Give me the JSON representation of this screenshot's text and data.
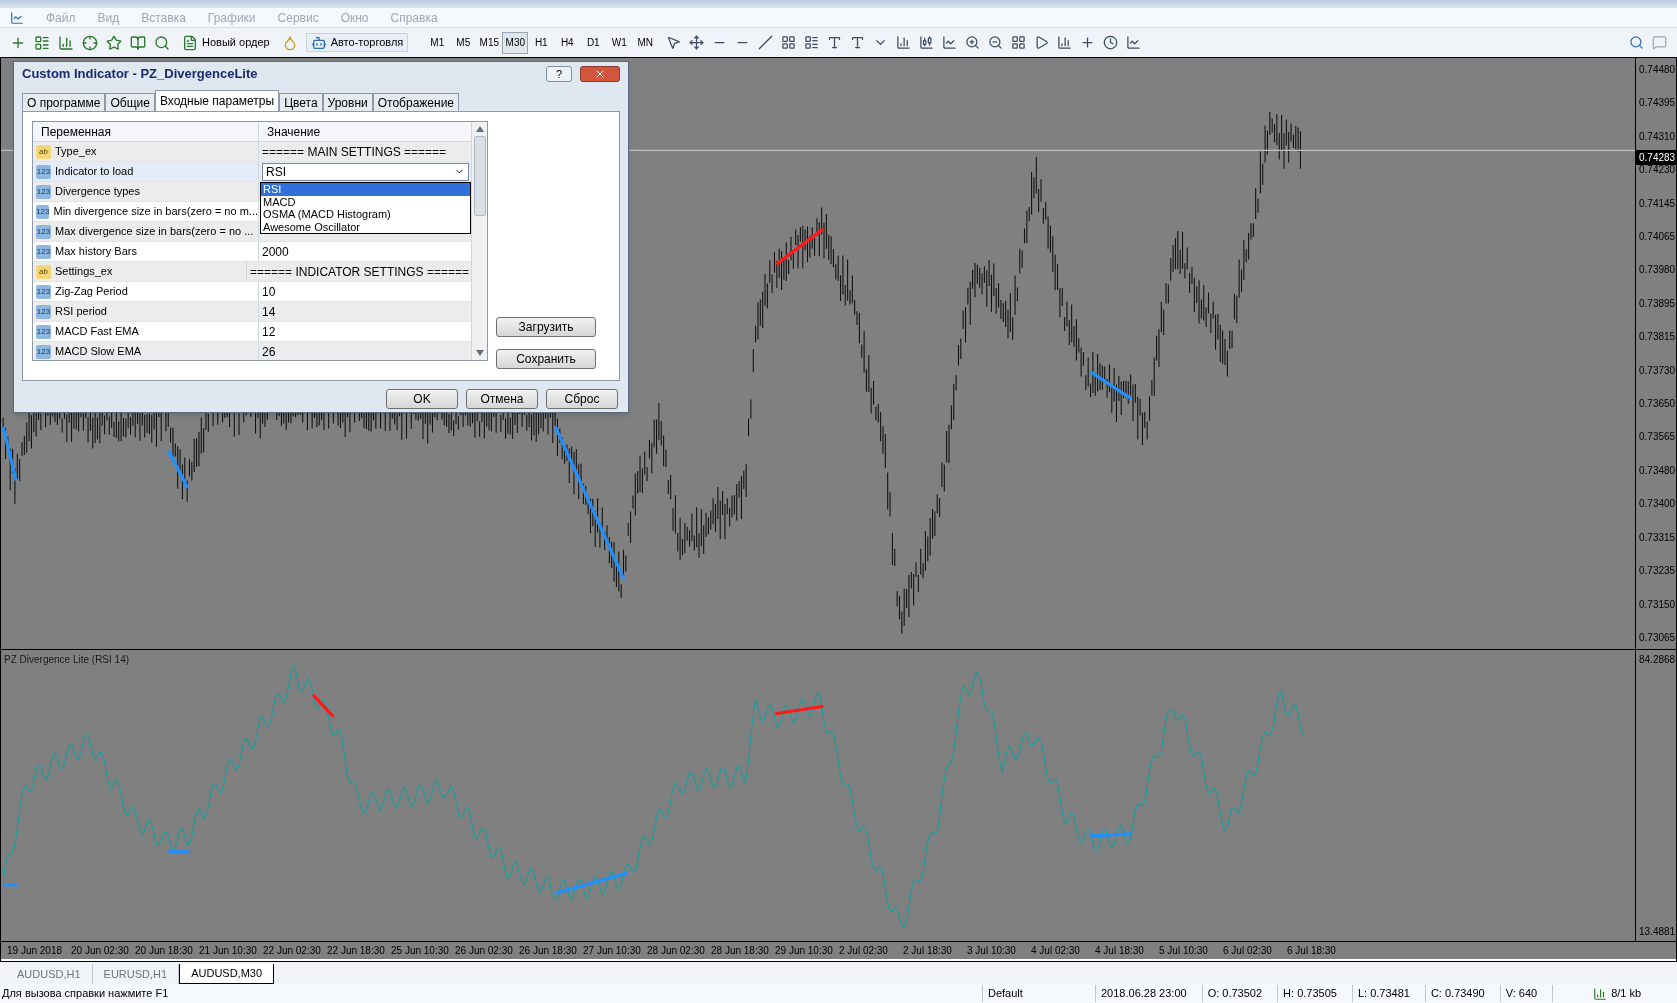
{
  "menu": {
    "disabled": true,
    "items": [
      "Файл",
      "Вид",
      "Вставка",
      "Графики",
      "Сервис",
      "Окно",
      "Справка"
    ]
  },
  "toolbar": {
    "new_order": "Новый ордер",
    "auto_trading": "Авто-торговля",
    "timeframes": [
      {
        "label": "M1",
        "selected": false
      },
      {
        "label": "M5",
        "selected": false
      },
      {
        "label": "M15",
        "selected": false
      },
      {
        "label": "M30",
        "selected": true
      },
      {
        "label": "H1",
        "selected": false
      },
      {
        "label": "H4",
        "selected": false
      },
      {
        "label": "D1",
        "selected": false
      },
      {
        "label": "W1",
        "selected": false
      },
      {
        "label": "MN",
        "selected": false
      }
    ]
  },
  "chart": {
    "price_axis": [
      "0.74480",
      "0.74395",
      "0.74310",
      "0.74230",
      "0.74145",
      "0.74065",
      "0.73980",
      "0.73895",
      "0.73815",
      "0.73730",
      "0.73650",
      "0.73565",
      "0.73480",
      "0.73400",
      "0.73315",
      "0.73235",
      "0.73150",
      "0.73065"
    ],
    "current_price": "0.74283",
    "indicator": {
      "title": "PZ Divergence Lite (RSI 14)",
      "max": "84.2868",
      "min": "13.4881"
    },
    "time_axis": [
      "19 Jun 2018",
      "20 Jun 02:30",
      "20 Jun 18:30",
      "21 Jun 10:30",
      "22 Jun 02:30",
      "22 Jun 18:30",
      "25 Jun 10:30",
      "26 Jun 02:30",
      "26 Jun 18:30",
      "27 Jun 10:30",
      "28 Jun 02:30",
      "28 Jun 18:30",
      "29 Jun 10:30",
      "2 Jul 02:30",
      "2 Jul 18:30",
      "3 Jul 10:30",
      "4 Jul 02:30",
      "4 Jul 18:30",
      "5 Jul 10:30",
      "6 Jul 02:30",
      "6 Jul 18:30"
    ]
  },
  "dialog": {
    "title": "Custom Indicator - PZ_DivergenceLite",
    "help": "?",
    "tabs": [
      {
        "label": "О программе",
        "selected": false
      },
      {
        "label": "Общие",
        "selected": false
      },
      {
        "label": "Входные параметры",
        "selected": true
      },
      {
        "label": "Цвета",
        "selected": false
      },
      {
        "label": "Уровни",
        "selected": false
      },
      {
        "label": "Отображение",
        "selected": false
      }
    ],
    "columns": [
      "Переменная",
      "Значение"
    ],
    "rows": [
      {
        "kind": "string",
        "badge": "ab",
        "name": "Type_ex",
        "value": "====== MAIN SETTINGS ======",
        "selected": false
      },
      {
        "kind": "number",
        "badge": "123",
        "name": "Indicator to load",
        "selected": true,
        "dropdown": {
          "value": "RSI",
          "options": [
            {
              "label": "RSI",
              "selected": true
            },
            {
              "label": "MACD",
              "selected": false
            },
            {
              "label": "OSMA (MACD Histogram)",
              "selected": false
            },
            {
              "label": "Awesome Oscillator",
              "selected": false
            }
          ]
        }
      },
      {
        "kind": "number",
        "badge": "123",
        "name": "Divergence types",
        "selected": false
      },
      {
        "kind": "number",
        "badge": "123",
        "name": "Min divergence size in bars(zero = no m...",
        "selected": false
      },
      {
        "kind": "number",
        "badge": "123",
        "name": "Max divergence size in bars(zero = no ...",
        "selected": false
      },
      {
        "kind": "number",
        "badge": "123",
        "name": "Max history Bars",
        "value": "2000",
        "selected": false
      },
      {
        "kind": "string",
        "badge": "ab",
        "name": "Settings_ex",
        "value": "====== INDICATOR SETTINGS ======",
        "selected": false
      },
      {
        "kind": "number",
        "badge": "123",
        "name": "Zig-Zag Period",
        "value": "10",
        "selected": false
      },
      {
        "kind": "number",
        "badge": "123",
        "name": "RSI period",
        "value": "14",
        "selected": false
      },
      {
        "kind": "number",
        "badge": "123",
        "name": "MACD Fast EMA",
        "value": "12",
        "selected": false
      },
      {
        "kind": "number",
        "badge": "123",
        "name": "MACD Slow EMA",
        "value": "26",
        "selected": false
      }
    ],
    "side_buttons": [
      "Загрузить",
      "Сохранить"
    ],
    "buttons": [
      "OK",
      "Отмена",
      "Сброс"
    ]
  },
  "chart_tabs": [
    {
      "label": "AUDUSD,H1",
      "selected": false
    },
    {
      "label": "EURUSD,H1",
      "selected": false
    },
    {
      "label": "AUDUSD,M30",
      "selected": true
    }
  ],
  "status_bar": {
    "help": "Для вызова справки нажмите F1",
    "profile": "Default",
    "fields": [
      "2018.06.28 23:00",
      "O: 0.73502",
      "H: 0.73505",
      "L: 0.73481",
      "C: 0.73490",
      "V: 640"
    ],
    "traffic": "8/1 kb"
  }
}
